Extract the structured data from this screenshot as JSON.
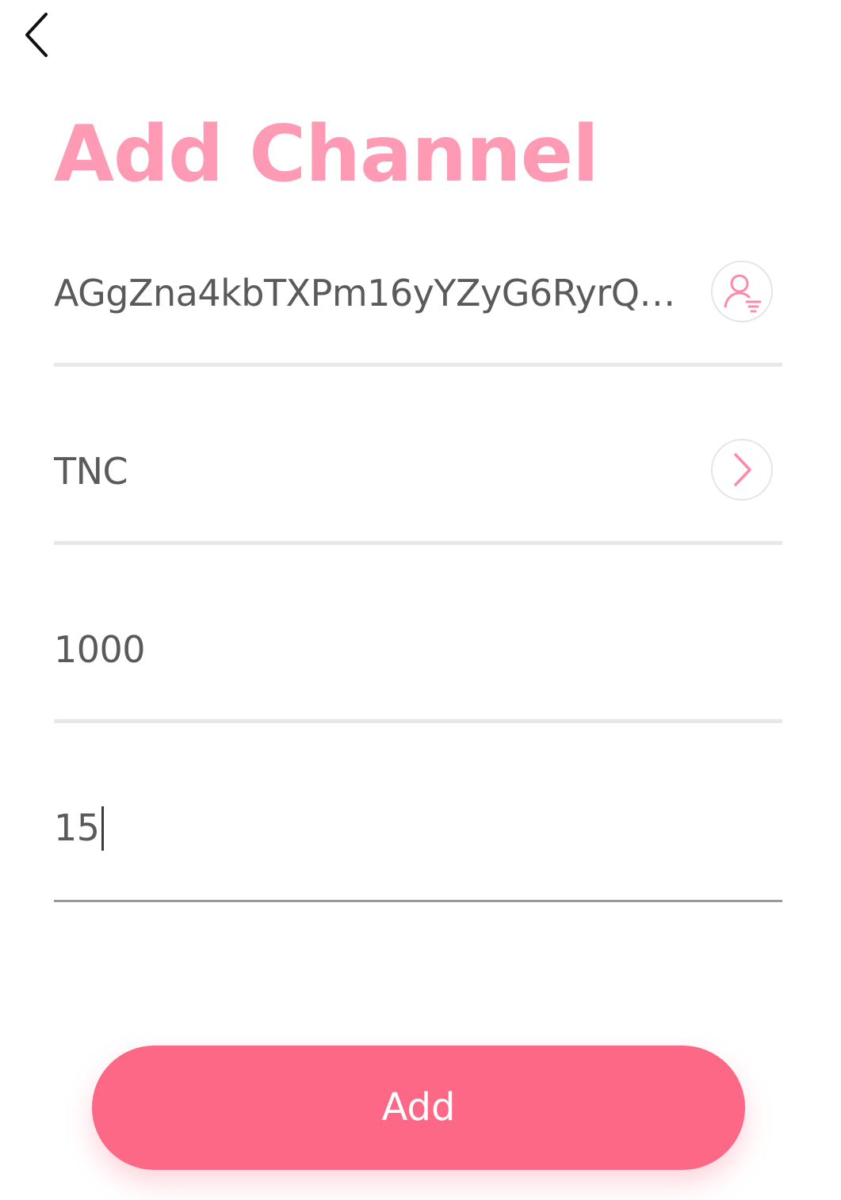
{
  "header": {
    "back_icon": "chevron-left-icon"
  },
  "page": {
    "title": "Add Channel"
  },
  "fields": {
    "address": {
      "value": "AGgZna4kbTXPm16yYZyG6RyrQz2…",
      "action_icon": "contact-select-icon"
    },
    "asset": {
      "value": "TNC",
      "action_icon": "chevron-right-icon"
    },
    "deposit": {
      "value": "1000"
    },
    "fee": {
      "value": "15"
    }
  },
  "actions": {
    "add_label": "Add"
  },
  "colors": {
    "accent": "#ff9ab5",
    "button": "#fc6886",
    "icon_pink": "#fc8aa8",
    "text": "#5a5a5a",
    "divider": "#e8e8e8"
  }
}
